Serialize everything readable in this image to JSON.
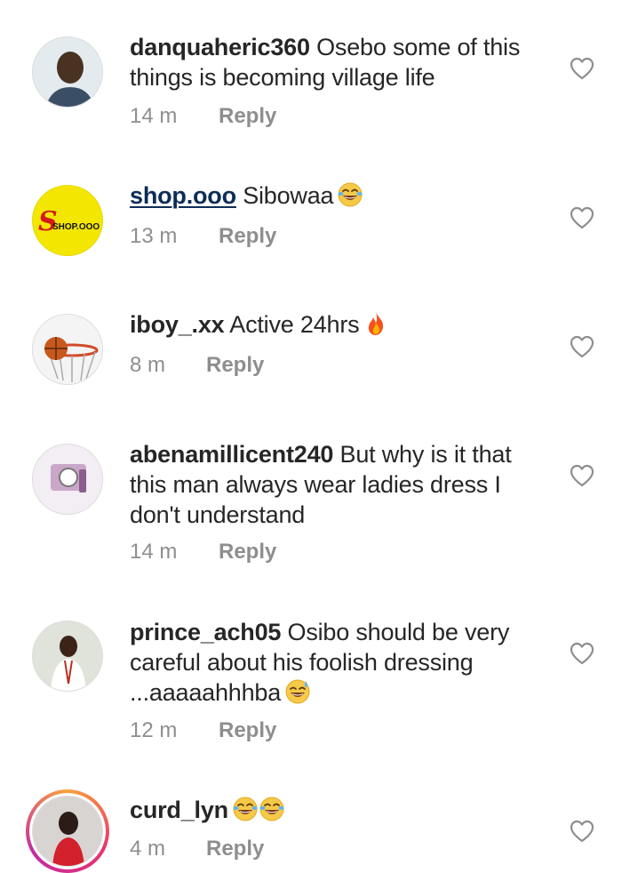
{
  "comments": [
    {
      "username": "danquaheric360",
      "text": "Osebo some of this things is becoming village life",
      "time": "14 m",
      "reply": "Reply"
    },
    {
      "username": "shop.ooo",
      "text": "Sibowaa",
      "time": "13 m",
      "reply": "Reply",
      "avatar_logo_text": "SHOP.OOO"
    },
    {
      "username": "iboy_.xx",
      "text": "Active 24hrs",
      "time": "8 m",
      "reply": "Reply"
    },
    {
      "username": "abenamillicent240",
      "text": "But why is it that this man always wear ladies dress I don't understand",
      "time": "14 m",
      "reply": "Reply"
    },
    {
      "username": "prince_ach05",
      "text": "Osibo should be very careful about his foolish dressing ...aaaaahhhba",
      "time": "12 m",
      "reply": "Reply"
    },
    {
      "username": "curd_lyn",
      "text": "",
      "time": "4 m",
      "reply": "Reply"
    }
  ],
  "icons": {
    "like": "heart-outline-icon",
    "laugh": "face-with-tears-of-joy-emoji",
    "fire": "fire-emoji",
    "sweat_smile": "grinning-face-with-sweat-emoji"
  },
  "colors": {
    "text": "#262626",
    "meta": "#8e8e8e",
    "link_user": "#0e2d57",
    "shop_avatar_bg": "#f3e600"
  }
}
